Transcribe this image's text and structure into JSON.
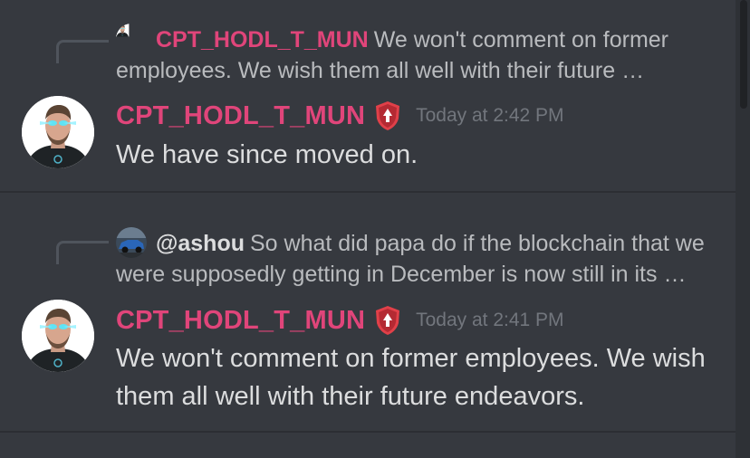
{
  "colors": {
    "author": "#e0457a",
    "background": "#36393f"
  },
  "messages": [
    {
      "reply": {
        "author": "CPT_HODL_T_MUN",
        "mention": "",
        "content": "We won't comment on former employees.  We wish them all well with their future …",
        "avatar_icon": "profile-avatar-icon"
      },
      "author": "CPT_HODL_T_MUN",
      "badge_icon": "shield-badge-icon",
      "timestamp": "Today at 2:42 PM",
      "text": "We have since moved on."
    },
    {
      "reply": {
        "author": "",
        "mention": "@ashou",
        "content": "So what did papa do if the blockchain that we were supposedly getting in December is now still in its …",
        "avatar_icon": "car-avatar-icon"
      },
      "author": "CPT_HODL_T_MUN",
      "badge_icon": "shield-badge-icon",
      "timestamp": "Today at 2:41 PM",
      "text": "We won't comment on former employees.  We wish them all well with their future endeavors."
    }
  ]
}
